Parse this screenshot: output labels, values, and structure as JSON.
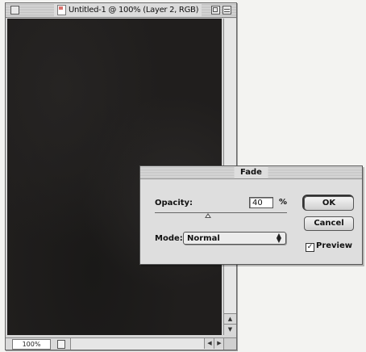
{
  "document_window": {
    "title": "Untitled-1 @ 100% (Layer 2, RGB)",
    "zoom_level": "100%",
    "icons": [
      "close-box-icon",
      "document-icon",
      "zoom-box-icon",
      "collapse-box-icon"
    ]
  },
  "fade_dialog": {
    "title": "Fade",
    "opacity_label": "Opacity:",
    "opacity_value": "40",
    "opacity_unit": "%",
    "opacity_slider_fraction": 0.4,
    "mode_label": "Mode:",
    "mode_selected": "Normal",
    "ok_label": "OK",
    "cancel_label": "Cancel",
    "preview_label": "Preview",
    "preview_checked": true
  }
}
